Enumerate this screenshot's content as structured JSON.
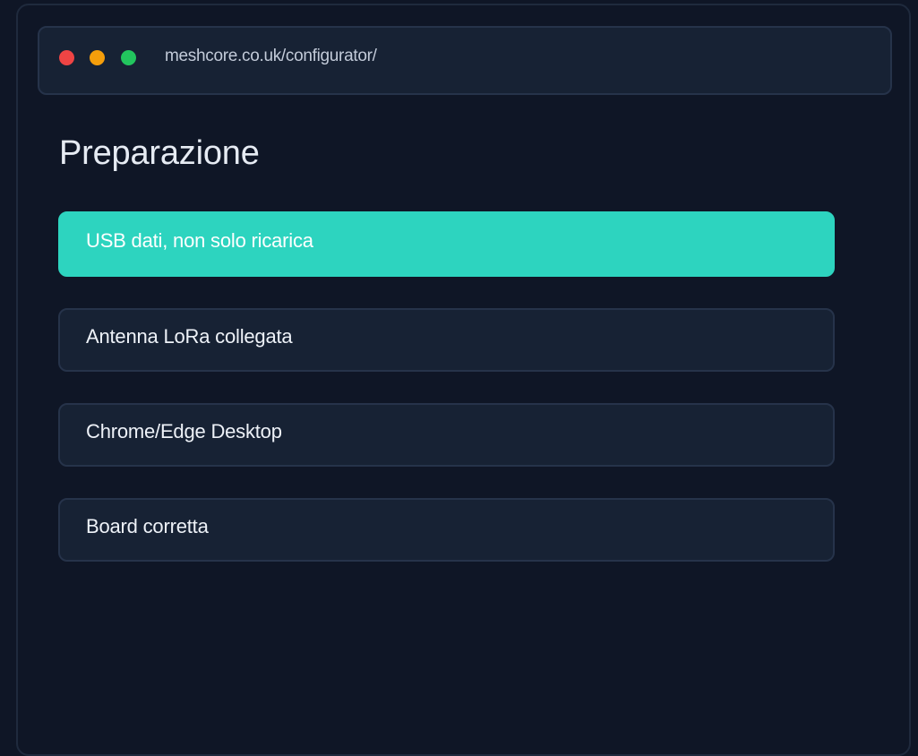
{
  "browser": {
    "url": "meshcore.co.uk/configurator/",
    "dots": {
      "close_color": "#ef4444",
      "minimize_color": "#f59e0b",
      "maximize_color": "#22c55e"
    }
  },
  "page": {
    "title": "Preparazione",
    "checklist": [
      {
        "label": "USB dati, non solo ricarica",
        "active": true
      },
      {
        "label": "Antenna LoRa collegata",
        "active": false
      },
      {
        "label": "Chrome/Edge Desktop",
        "active": false
      },
      {
        "label": "Board corretta",
        "active": false
      }
    ]
  },
  "colors": {
    "background": "#0f1626",
    "panel": "#172234",
    "accent": "#2dd4bf"
  }
}
